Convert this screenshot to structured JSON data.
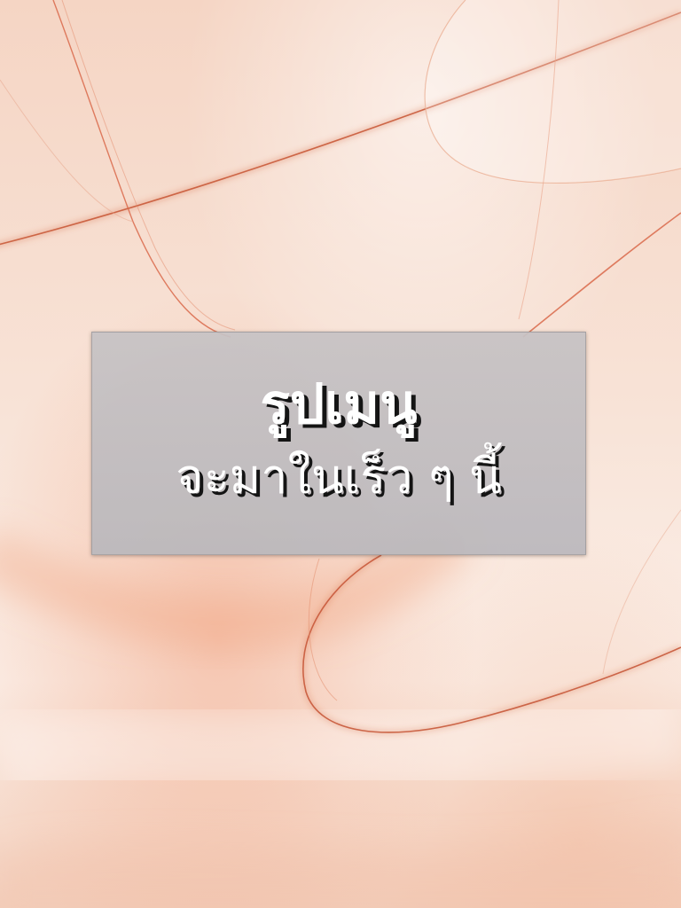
{
  "placeholder": {
    "title": "รูปเมนู",
    "subtitle": "จะมาในเร็ว ๆ นี้"
  },
  "colors": {
    "background": "#f6dccd",
    "accent_line": "#d9684a",
    "panel": "#c3c0c2",
    "text": "#ffffff",
    "text_shadow": "#141414"
  }
}
